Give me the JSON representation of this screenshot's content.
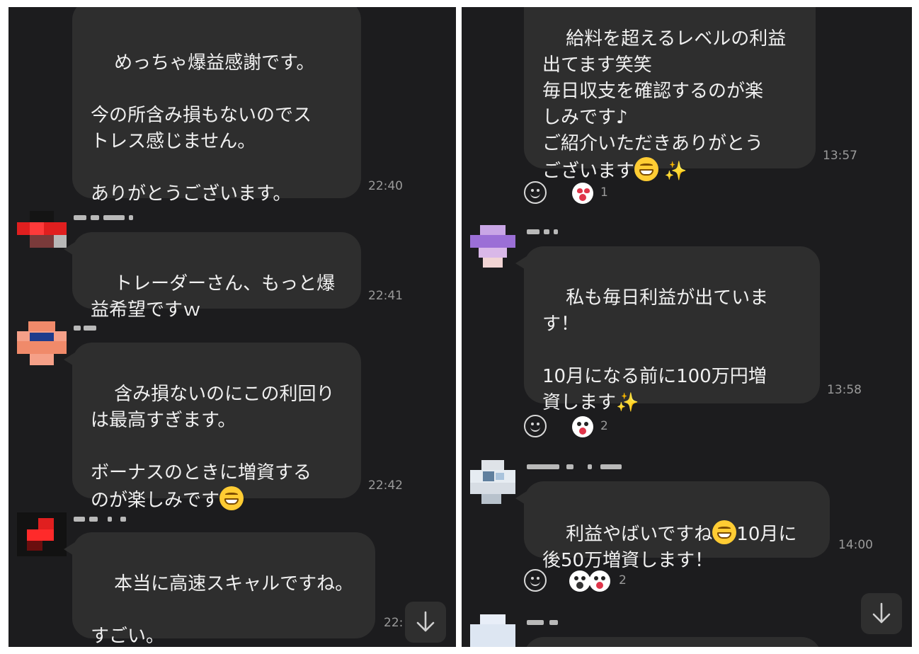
{
  "left": {
    "messages": [
      {
        "text": "めっちゃ爆益感謝です。\n\n今の所含み損もないのでス\nトレス感じません。\n\nありがとうございます。",
        "time": "22:40"
      },
      {
        "text": "トレーダーさん、もっと爆\n益希望ですｗ",
        "time": "22:41"
      },
      {
        "text": "含み損ないのにこの利回り\nは最高すぎます。\n\nボーナスのときに増資する\nのが楽しみです",
        "time": "22:42"
      },
      {
        "text": "本当に高速スキャルですね。\n\nすごい。",
        "time": "22:"
      }
    ]
  },
  "right": {
    "messages": [
      {
        "text": "給料を超えるレベルの利益\n出てます笑笑\n毎日収支を確認するのが楽\nしみです♪\nご紹介いただきありがとう\nございます",
        "time": "13:57",
        "reaction_count": "1"
      },
      {
        "text": "私も毎日利益が出ていま\nす！\n\n10月になる前に100万円増\n資します",
        "time": "13:58",
        "reaction_count": "2"
      },
      {
        "text": "利益やばいですね",
        "text2": "10月に\n後50万増資します！",
        "time": "14:00",
        "reaction_count": "2"
      }
    ]
  },
  "icons": {
    "react": "smiley-outline-icon",
    "scroll": "arrow-down-icon",
    "sticker_heart_eyes": "heart-eyes-face-icon",
    "sticker_surprised": "surprised-face-icon"
  },
  "colors": {
    "background": "#1c1c1e",
    "bubble": "#2e2e2e",
    "text": "#f0f0f0",
    "timestamp": "#9a9a9a"
  }
}
